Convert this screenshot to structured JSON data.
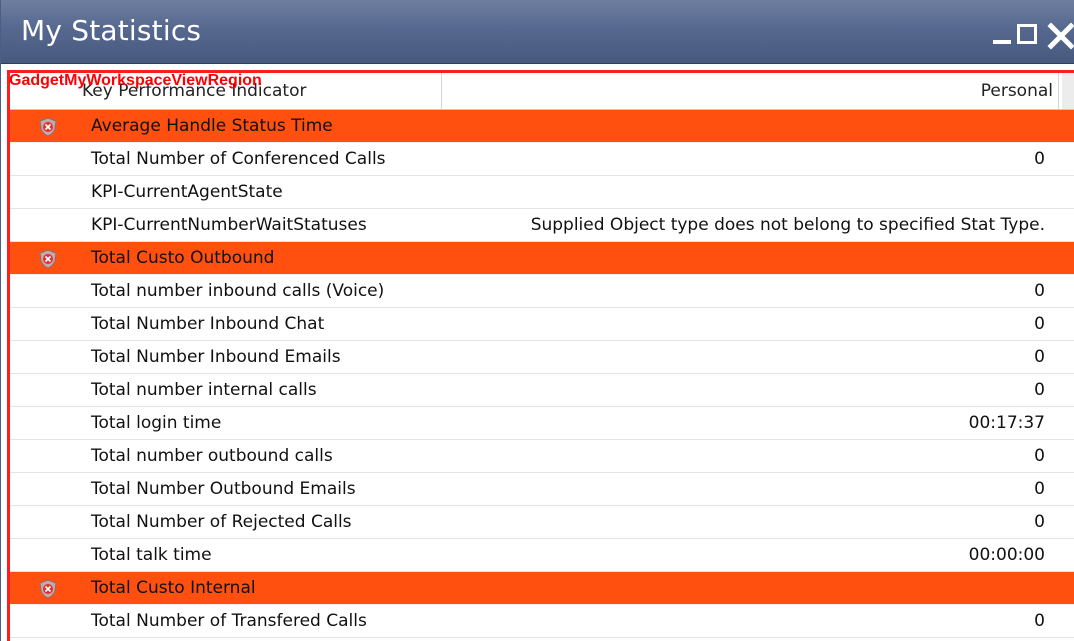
{
  "window": {
    "title": "My Statistics",
    "minimize_icon": "minimize-icon",
    "maximize_icon": "maximize-icon",
    "close_icon": "close-icon"
  },
  "region_label": "GadgetMyWorkspaceViewRegion",
  "table": {
    "columns": [
      "Key Performance Indicator",
      "Personal"
    ],
    "rows": [
      {
        "type": "group",
        "label": "Average Handle Status Time",
        "value": "",
        "icon": "alert-shield-icon"
      },
      {
        "type": "item",
        "label": "Total Number of Conferenced Calls",
        "value": "0"
      },
      {
        "type": "item",
        "label": "KPI-CurrentAgentState",
        "value": ""
      },
      {
        "type": "item",
        "label": "KPI-CurrentNumberWaitStatuses",
        "value": "Supplied Object type does not belong to specified Stat Type."
      },
      {
        "type": "group",
        "label": "Total Custo Outbound",
        "value": "",
        "icon": "alert-shield-icon"
      },
      {
        "type": "item",
        "label": "Total number inbound calls (Voice)",
        "value": "0"
      },
      {
        "type": "item",
        "label": "Total Number Inbound Chat",
        "value": "0"
      },
      {
        "type": "item",
        "label": "Total Number Inbound Emails",
        "value": "0"
      },
      {
        "type": "item",
        "label": "Total number internal calls",
        "value": "0"
      },
      {
        "type": "item",
        "label": "Total login time",
        "value": "00:17:37"
      },
      {
        "type": "item",
        "label": "Total number outbound calls",
        "value": "0"
      },
      {
        "type": "item",
        "label": "Total Number Outbound Emails",
        "value": "0"
      },
      {
        "type": "item",
        "label": "Total Number of Rejected Calls",
        "value": "0"
      },
      {
        "type": "item",
        "label": "Total talk time",
        "value": "00:00:00"
      },
      {
        "type": "group",
        "label": "Total Custo Internal",
        "value": "",
        "icon": "alert-shield-icon"
      },
      {
        "type": "item",
        "label": "Total Number of Transfered Calls",
        "value": "0"
      }
    ]
  },
  "colors": {
    "titlebar": "#56688f",
    "group_row": "#ff5010",
    "region_outline": "#ff1d1d"
  }
}
